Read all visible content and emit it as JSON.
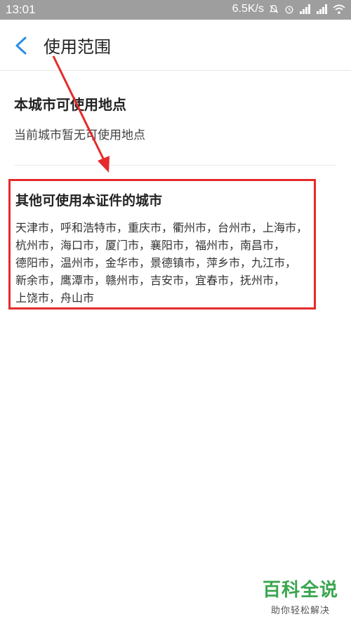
{
  "status_bar": {
    "time": "13:01",
    "network_speed": "6.5K/s",
    "icons": [
      "mute-bell-icon",
      "alarm-icon",
      "signal-icon",
      "signal-icon",
      "wifi-icon"
    ]
  },
  "header": {
    "title": "使用范围",
    "back_icon": "chevron-left-icon",
    "accent": "#2a8ee6"
  },
  "current_city": {
    "title": "本城市可使用地点",
    "message": "当前城市暂无可使用地点"
  },
  "other_cities": {
    "title": "其他可使用本证件的城市",
    "lines": [
      "天津市，呼和浩特市，重庆市，衢州市，台州市，上海市，",
      "杭州市，海口市，厦门市，襄阳市，福州市，南昌市，",
      "德阳市，温州市，金华市，景德镇市，萍乡市，九江市，",
      "新余市，鹰潭市，赣州市，吉安市，宜春市，抚州市，",
      "上饶市，舟山市"
    ]
  },
  "annotation": {
    "box_color": "#e52b2b",
    "arrow_color": "#e52b2b"
  },
  "watermark": {
    "main": "百科全说",
    "sub": "助你轻松解决",
    "color": "#3aa64f"
  }
}
